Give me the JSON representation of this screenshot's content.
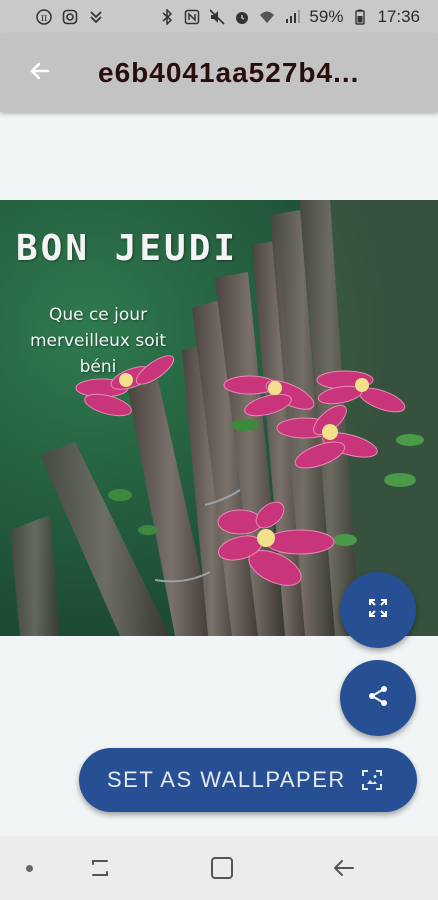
{
  "status_bar": {
    "left_icons": [
      "pi-icon",
      "instagram-icon",
      "download-icon"
    ],
    "right_icons": [
      "bluetooth-icon",
      "nfc-icon",
      "mute-icon",
      "alarm-icon",
      "wifi-icon",
      "signal-icon",
      "battery-icon"
    ],
    "battery": "59%",
    "time": "17:36"
  },
  "app_bar": {
    "title": "e6b4041aa527b4...",
    "back_icon": "arrow-back-icon"
  },
  "image": {
    "title": "BON JEUDI",
    "subtitle": "Que ce jour merveilleux soit béni"
  },
  "actions": {
    "expand_icon": "fullscreen-icon",
    "share_icon": "share-icon",
    "wallpaper_label": "SET AS WALLPAPER",
    "wallpaper_icon": "wallpaper-icon"
  },
  "nav_bar": {
    "icons": [
      "recent-apps-icon",
      "home-icon",
      "back-icon"
    ]
  },
  "colors": {
    "accent": "#274f93",
    "app_bar": "#c3c3c3",
    "background": "#f1f5f5"
  }
}
